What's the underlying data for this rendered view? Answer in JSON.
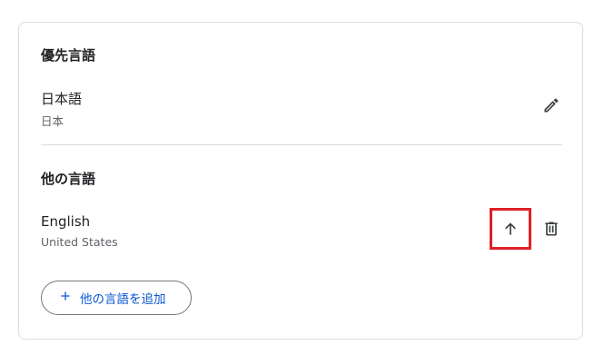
{
  "preferred": {
    "title": "優先言語",
    "language": "日本語",
    "region": "日本",
    "edit_icon": "pencil-icon"
  },
  "others": {
    "title": "他の言語",
    "items": [
      {
        "language": "English",
        "region": "United States",
        "move_up_icon": "arrow-up-icon",
        "delete_icon": "trash-icon"
      }
    ]
  },
  "add_button": {
    "icon": "plus-icon",
    "label": "他の言語を追加"
  },
  "colors": {
    "accent": "#0b57d0",
    "highlight": "#e01f26",
    "border": "#dadce0"
  }
}
